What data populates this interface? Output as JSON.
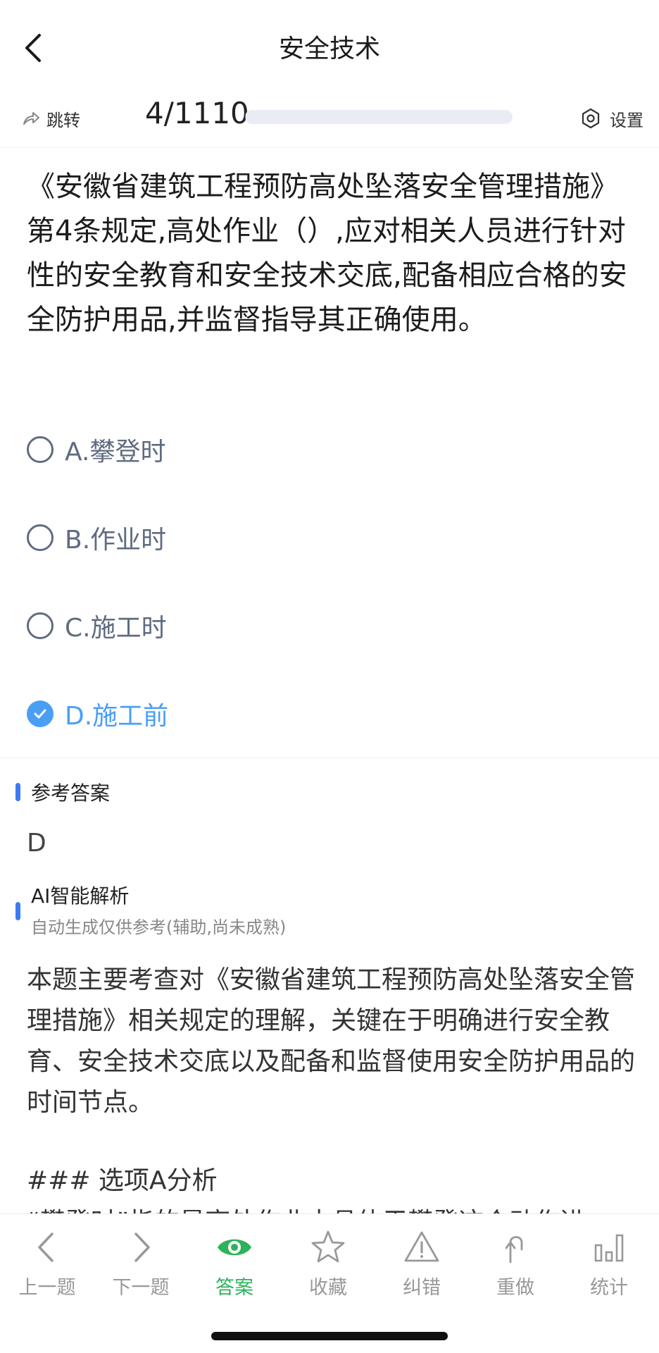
{
  "header": {
    "title": "安全技术"
  },
  "toolbar": {
    "jump_label": "跳转",
    "progress_text": "4/1110",
    "progress_fraction": 0.0036,
    "settings_label": "设置"
  },
  "question": {
    "text": "《安徽省建筑工程预防高处坠落安全管理措施》第4条规定,高处作业（）,应对相关人员进行针对性的安全教育和安全技术交底,配备相应合格的安全防护用品,并监督指导其正确使用。"
  },
  "options": [
    {
      "label": "A.攀登时",
      "selected": false
    },
    {
      "label": "B.作业时",
      "selected": false
    },
    {
      "label": "C.施工时",
      "selected": false
    },
    {
      "label": "D.施工前",
      "selected": true
    }
  ],
  "reference": {
    "title": "参考答案",
    "value": "D"
  },
  "ai": {
    "title": "AI智能解析",
    "subtitle": "自动生成仅供参考(辅助,尚未成熟)",
    "paragraph": "本题主要考查对《安徽省建筑工程预防高处坠落安全管理措施》相关规定的理解，关键在于明确进行安全教育、安全技术交底以及配备和监督使用安全防护用品的时间节点。",
    "heading": "### 选项A分析",
    "cut_line": "“攀登时”指的是高处作业中具体于攀登这个动作进"
  },
  "tabs": [
    {
      "label": "上一题",
      "icon": "chevron-left-icon"
    },
    {
      "label": "下一题",
      "icon": "chevron-right-icon"
    },
    {
      "label": "答案",
      "icon": "eye-icon",
      "active": true
    },
    {
      "label": "收藏",
      "icon": "star-icon"
    },
    {
      "label": "纠错",
      "icon": "warning-icon"
    },
    {
      "label": "重做",
      "icon": "redo-icon"
    },
    {
      "label": "统计",
      "icon": "bar-chart-icon"
    }
  ],
  "colors": {
    "accent": "#4a9ff5",
    "brand_blue": "#3d7bf5",
    "active_tab": "#2bb35a",
    "option_text": "#5f6b80"
  }
}
